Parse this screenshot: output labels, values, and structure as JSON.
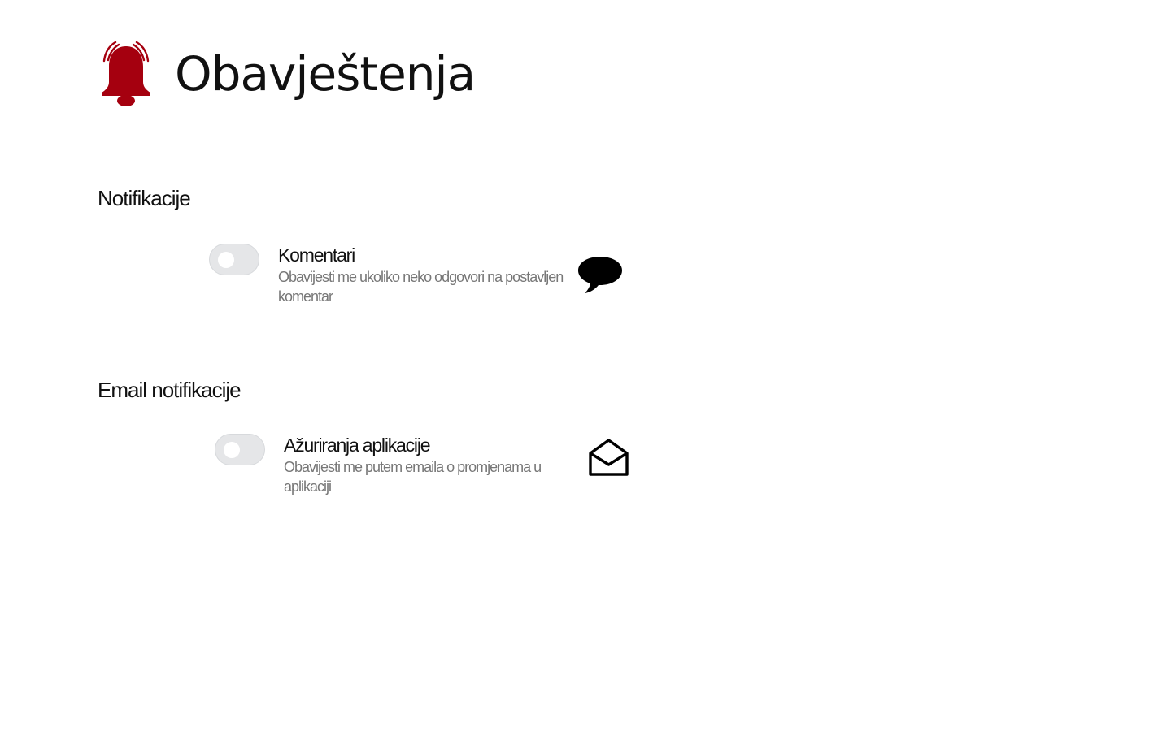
{
  "header": {
    "title": "Obavještenja",
    "icon": "bell-ringing-icon",
    "icon_color": "#a5000f"
  },
  "sections": [
    {
      "title": "Notifikacije",
      "items": [
        {
          "label": "Komentari",
          "description": "Obavijesti me ukoliko neko odgovori na postavljen komentar",
          "enabled": false,
          "icon": "speech-bubble-icon"
        }
      ]
    },
    {
      "title": "Email notifikacije",
      "items": [
        {
          "label": "Ažuriranja aplikacije",
          "description": "Obavijesti me putem emaila o promjenama u aplikaciji",
          "enabled": false,
          "icon": "open-envelope-icon"
        }
      ]
    }
  ],
  "colors": {
    "toggle_off": "#e5e6e8",
    "description_text": "#777777"
  }
}
